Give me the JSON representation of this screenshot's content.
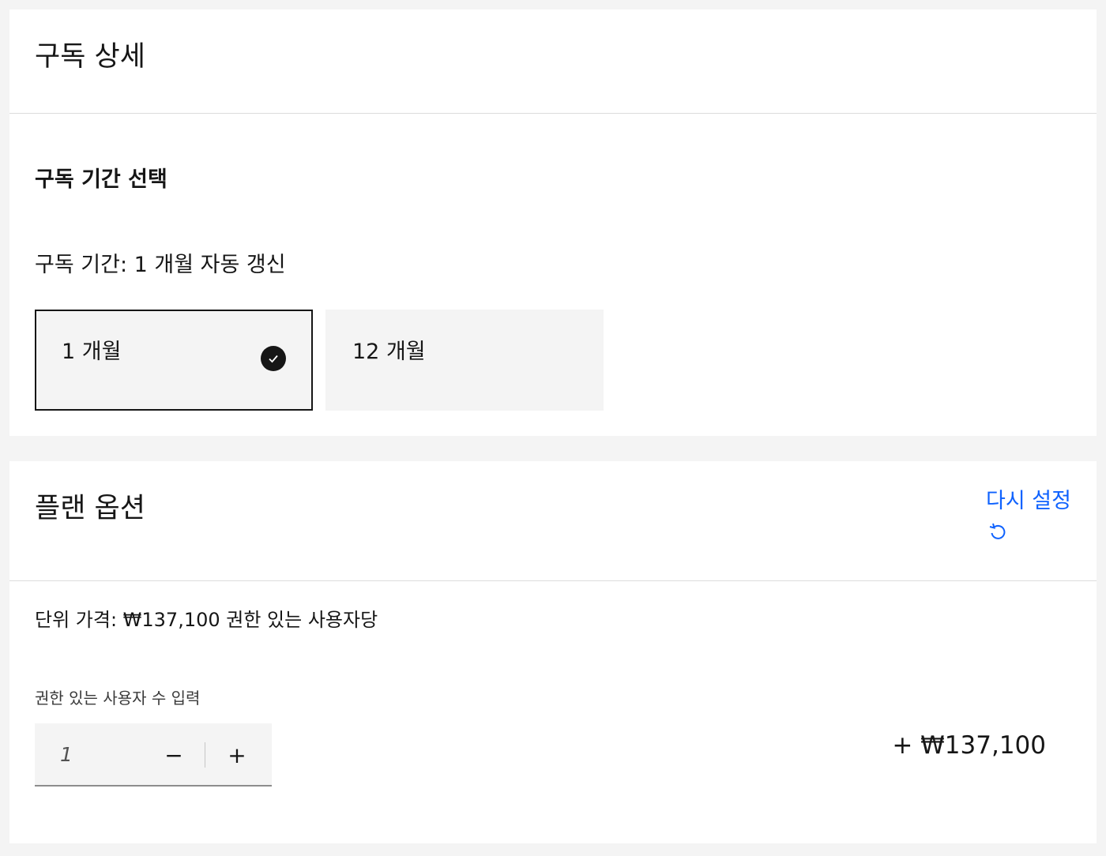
{
  "subscription": {
    "title": "구독 상세",
    "term_heading": "구독 기간 선택",
    "term_label": "구독 기간: 1 개월 자동 갱신",
    "options": [
      {
        "label": "1 개월",
        "selected": true
      },
      {
        "label": "12 개월",
        "selected": false
      }
    ]
  },
  "plan": {
    "title": "플랜 옵션",
    "reset_label": "다시 설정",
    "reset_icon": "revert-icon",
    "unit_price": "단위 가격: ₩137,100 권한 있는 사용자당",
    "quantity_label": "권한 있는 사용자 수 입력",
    "quantity_value": "1",
    "decrement_symbol": "−",
    "increment_symbol": "+",
    "line_total": "+ ₩137,100"
  },
  "colors": {
    "background": "#f4f4f4",
    "card": "#ffffff",
    "text": "#161616",
    "link": "#0f62fe"
  }
}
